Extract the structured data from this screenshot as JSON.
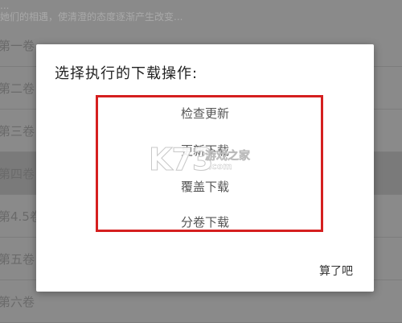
{
  "background": {
    "top_text": [
      "...",
      "她们的相遇，使清澄的态度逐渐产生改变..."
    ],
    "volumes": [
      {
        "label": "第一卷"
      },
      {
        "label": "第二卷"
      },
      {
        "label": "第三卷"
      },
      {
        "label": "第四卷"
      },
      {
        "label": "第4.5卷"
      },
      {
        "label": "第五卷"
      },
      {
        "label": "第六卷"
      }
    ]
  },
  "dialog": {
    "title": "选择执行的下载操作:",
    "options": [
      {
        "label": "检查更新"
      },
      {
        "label": "更新下载"
      },
      {
        "label": "覆盖下载"
      },
      {
        "label": "分卷下载"
      }
    ],
    "cancel_label": "算了吧",
    "highlight_color": "#d51f1f"
  },
  "watermark": {
    "logo": "K73",
    "text_cn": "游戏之家",
    "text_domain": ".com"
  }
}
